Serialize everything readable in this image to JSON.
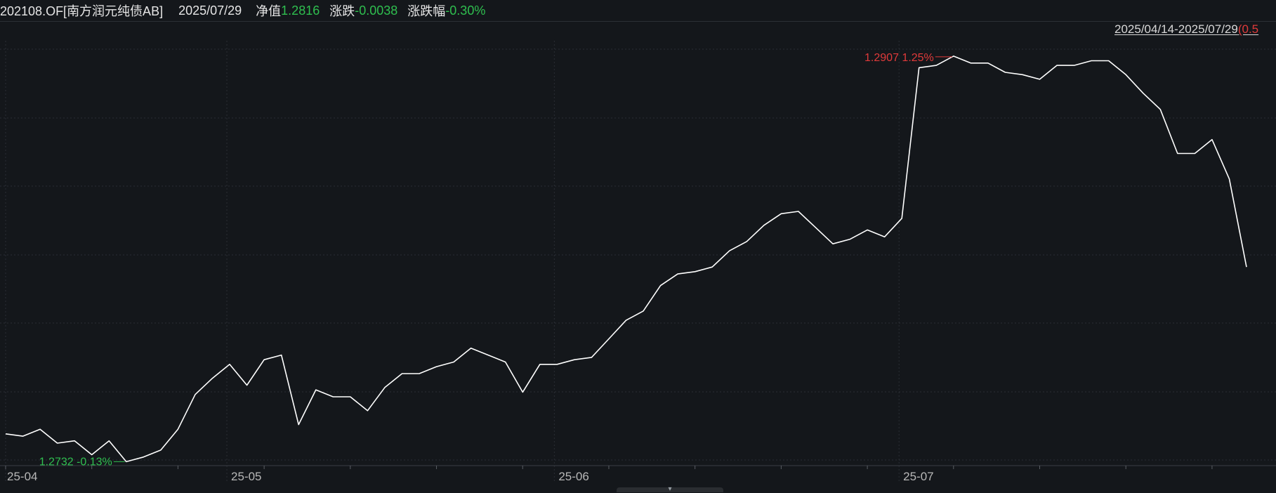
{
  "header": {
    "code_name": "202108.OF[南方润元纯债AB]",
    "date": "2025/07/29",
    "nav_label": "净值",
    "nav_value": "1.2816",
    "change_label": "涨跌",
    "change_value": "-0.0038",
    "change_pct_label": "涨跌幅",
    "change_pct_value": "-0.30%"
  },
  "range": {
    "dates": "2025/04/14-2025/07/29",
    "pct_partial": "(0.5"
  },
  "colors": {
    "background": "#14171b",
    "line": "#ffffff",
    "up": "#e03a3a",
    "down": "#2fbf4f",
    "grid": "#2a2e34",
    "axis_text": "#b8b8b8"
  },
  "chart_data": {
    "type": "line",
    "x_tick_labels": [
      "25-04",
      "25-05",
      "25-06",
      "25-07"
    ],
    "x": [
      "04-14",
      "04-15",
      "04-16",
      "04-17",
      "04-18",
      "04-21",
      "04-22",
      "04-23",
      "04-24",
      "04-25",
      "04-28",
      "04-29",
      "04-30",
      "05-06",
      "05-07",
      "05-08",
      "05-09",
      "05-12",
      "05-13",
      "05-14",
      "05-15",
      "05-16",
      "05-19",
      "05-20",
      "05-21",
      "05-22",
      "05-23",
      "05-26",
      "05-27",
      "05-28",
      "05-29",
      "05-30",
      "06-03",
      "06-04",
      "06-05",
      "06-06",
      "06-09",
      "06-10",
      "06-11",
      "06-12",
      "06-13",
      "06-16",
      "06-17",
      "06-18",
      "06-19",
      "06-20",
      "06-23",
      "06-24",
      "06-25",
      "06-26",
      "06-27",
      "06-30",
      "07-01",
      "07-02",
      "07-03",
      "07-04",
      "07-07",
      "07-08",
      "07-09",
      "07-10",
      "07-11",
      "07-14",
      "07-15",
      "07-16",
      "07-17",
      "07-18",
      "07-21",
      "07-22",
      "07-23",
      "07-24",
      "07-25",
      "07-28",
      "07-29"
    ],
    "y": [
      1.2744,
      1.2743,
      1.2746,
      1.274,
      1.2741,
      1.2735,
      1.2741,
      1.2732,
      1.2734,
      1.2737,
      1.2746,
      1.2761,
      1.2768,
      1.2774,
      1.2765,
      1.2776,
      1.2778,
      1.2748,
      1.2763,
      1.276,
      1.276,
      1.2754,
      1.2764,
      1.277,
      1.277,
      1.2773,
      1.2775,
      1.2781,
      1.2778,
      1.2775,
      1.2762,
      1.2774,
      1.2774,
      1.2776,
      1.2777,
      1.2785,
      1.2793,
      1.2797,
      1.2808,
      1.2813,
      1.2814,
      1.2816,
      1.2823,
      1.2827,
      1.2834,
      1.2839,
      1.284,
      1.2833,
      1.2826,
      1.2828,
      1.2832,
      1.2829,
      1.2837,
      1.2902,
      1.2903,
      1.2907,
      1.2904,
      1.2904,
      1.29,
      1.2899,
      1.2897,
      1.2903,
      1.2903,
      1.2905,
      1.2905,
      1.2899,
      1.2891,
      1.2884,
      1.2865,
      1.2865,
      1.2871,
      1.2854,
      1.2816
    ],
    "y_values_note_free": true,
    "max_label": "1.2907 1.25%",
    "min_label": "1.2732 -0.13%",
    "grid": true
  }
}
